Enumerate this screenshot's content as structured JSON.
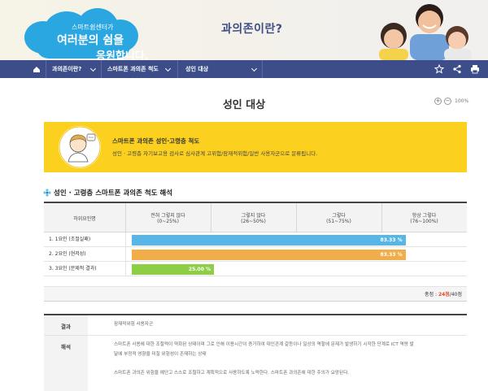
{
  "banner": {
    "cloud_line1": "스마트쉼센터가",
    "cloud_line2": "여러분의 쉼을",
    "cloud_line3": "응원합니다.",
    "title": "과의존이란?"
  },
  "nav": {
    "items": [
      "과의존이란?",
      "스마트폰 과의존 척도",
      "성인 대상"
    ]
  },
  "page": {
    "title": "성인 대상",
    "zoom_label": "100%"
  },
  "info": {
    "title": "스마트폰 과의존 성인·고령층 척도",
    "desc": "성인 · 고령층 자기보고용 검사로 심사관계 고위험/잠재적위험/일반 사용자군으로 문류됩니다."
  },
  "section": {
    "title": "성인 · 고령층 스마트폰 과의존 척도 해석"
  },
  "score_table": {
    "header_factor": "하위요인명",
    "columns": [
      {
        "label": "전혀 그렇지 않다",
        "range": "(0~25%)"
      },
      {
        "label": "그렇지 않다",
        "range": "(26~50%)"
      },
      {
        "label": "그렇다",
        "range": "(51~75%)"
      },
      {
        "label": "항상 그렇다",
        "range": "(76~100%)"
      }
    ],
    "rows": [
      {
        "name": "1. 1요인 (조절실패)",
        "percent": 83.33,
        "percent_label": "83.33 %",
        "color": "#58b6e6"
      },
      {
        "name": "2. 2요인 (현저성)",
        "percent": 83.33,
        "percent_label": "83.33 %",
        "color": "#f0ad4a"
      },
      {
        "name": "3. 3요인 (문제적 결과)",
        "percent": 25.0,
        "percent_label": "25.00 %",
        "color": "#8ccf45"
      }
    ],
    "total_prefix": "총점 : ",
    "total_score": "24점",
    "total_suffix": "/40점"
  },
  "result_table": {
    "result_label": "결과",
    "result_value": "잠재적위험 사용자군",
    "interp_label": "해석",
    "interp_line1": "스마트폰 사용에 대한 조절력이 약화된 상태이며 그로 인해 이용시간이 증가하여 대인관계 갈등이나 일상의 역할에 문제가 발생하기 시작한 단계로 ICT 역량 발",
    "interp_line2": "달에 부정적 영향을 미칠 위험성이 존재하는 상태",
    "interp_line3": "스마트폰 과의존 위험을 예단고 스스로 조절하고 계획적으로 사용하도록 노력한다. 스마트폰 과의존에 대한 주의가 요망된다."
  },
  "colors": {
    "nav": "#3c4d8a",
    "info_box": "#fbd01f",
    "cloud": "#2aa6e0",
    "total_highlight": "#e1492b"
  }
}
